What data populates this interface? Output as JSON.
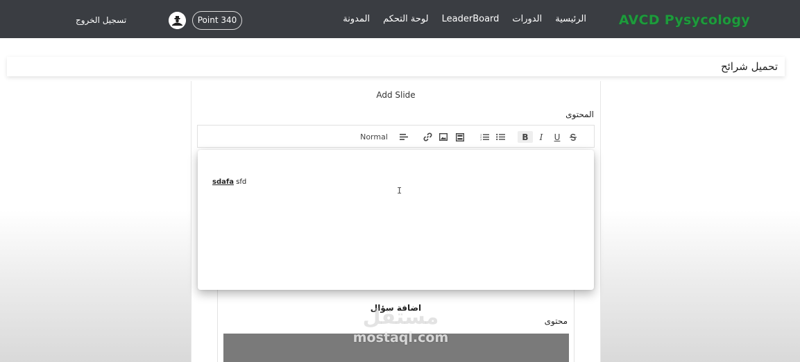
{
  "nav": {
    "brand": "AVCD Pysycology",
    "links": [
      "الرئيسية",
      "الدورات",
      "LeaderBoard",
      "لوحة التحكم",
      "المدونة"
    ],
    "points": "Point 340",
    "logout": "تسجيل الخروج",
    "brand_color": "#1e9a3c",
    "background_color": "#3a3d42"
  },
  "page": {
    "title": "تحميل شرائح"
  },
  "slide_form": {
    "heading": "Add Slide",
    "content_label": "المحتوى",
    "toolbar": {
      "format_select": "Normal",
      "icons": [
        "align-icon",
        "link-icon",
        "image-icon",
        "video-icon",
        "ordered-list-icon",
        "bullet-list-icon",
        "bold-icon",
        "italic-icon",
        "underline-icon",
        "strike-icon"
      ],
      "bold_label": "B",
      "italic_label": "I",
      "underline_label": "U"
    },
    "editor": {
      "bold_text": "sdafa",
      "plain_text": " sfd",
      "cursor_glyph": "I"
    }
  },
  "question_form": {
    "heading": "اضافة سؤال",
    "content_label": "محتوى"
  },
  "watermark": {
    "arabic": "مستقل",
    "latin": "mostaql.com"
  }
}
